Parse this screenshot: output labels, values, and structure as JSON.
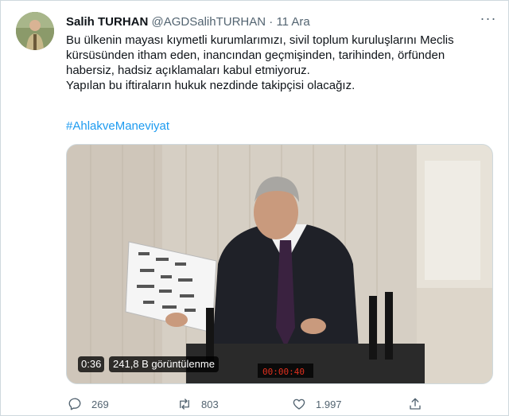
{
  "tweet": {
    "author_name": "Salih TURHAN",
    "handle": "@AGDSalihTURHAN",
    "separator": "·",
    "timestamp": "11 Ara",
    "more_label": "···",
    "text": "Bu ülkenin mayası kıymetli kurumlarımızı, sivil toplum kuruluşlarını Meclis\nkürsüsünden itham eden, inancından geçmişinden, tarihinden, örfünden\nhabersiz, hadsiz açıklamaları kabul etmiyoruz.\nYapılan bu iftiraların  hukuk nezdinde takipçisi olacağız.",
    "hashtag": "#AhlakveManeviyat"
  },
  "video": {
    "duration": "0:36",
    "views": "241,8 B görüntülenme",
    "timer_display": "00:00:40"
  },
  "actions": {
    "reply_count": "269",
    "retweet_count": "803",
    "like_count": "1.997"
  },
  "colors": {
    "link": "#1d9bf0",
    "secondary": "#536471",
    "border": "#cfd9de"
  },
  "icons": [
    "avatar-photo",
    "more-icon",
    "reply-icon",
    "retweet-icon",
    "like-icon",
    "share-icon"
  ]
}
